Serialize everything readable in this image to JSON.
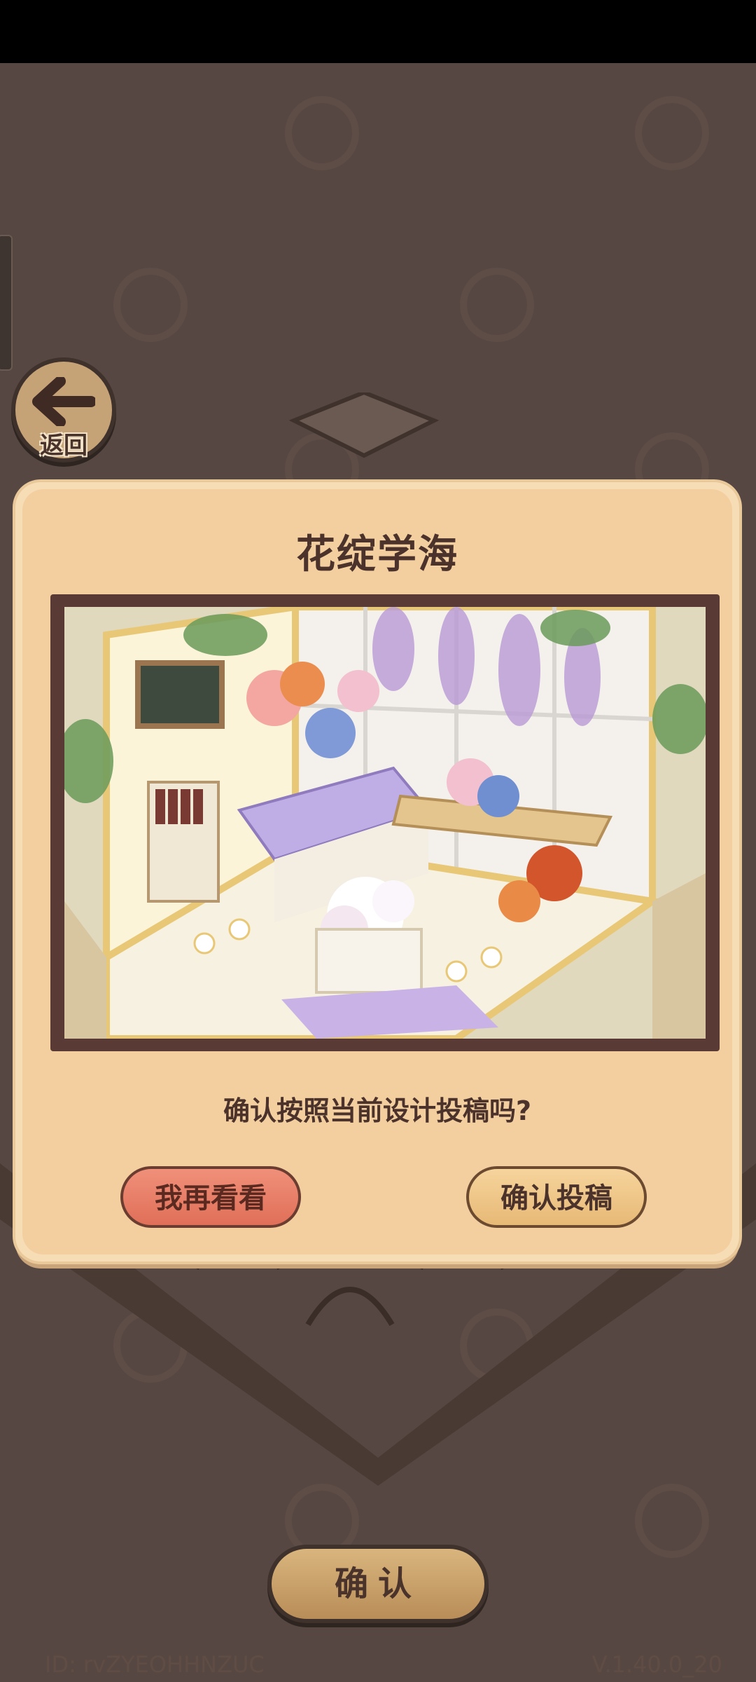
{
  "back": {
    "label": "返回",
    "icon": "arrow-left-icon"
  },
  "dialog": {
    "title": "花绽学海",
    "question": "确认按照当前设计投稿吗?",
    "cancel_label": "我再看看",
    "submit_label": "确认投稿"
  },
  "footer": {
    "confirm_label": "确认",
    "id_text": "ID: rvZYEOHHNZUC",
    "version_text": "V.1.40.0_20"
  },
  "colors": {
    "background": "#574742",
    "dialog": "#f3cfa0",
    "cancel_button": "#e47a63",
    "submit_button": "#efc88c"
  }
}
